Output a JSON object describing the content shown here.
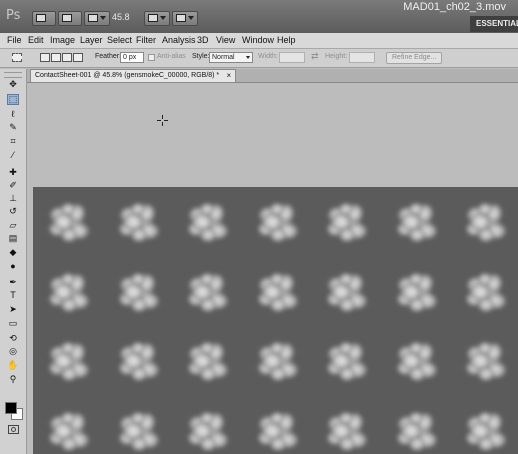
{
  "app": {
    "logo": "Ps",
    "window_title": "MAD01_ch02_3.mov",
    "workspace_label": "ESSENTIAL",
    "zoom_level": "45.8"
  },
  "menu": [
    "File",
    "Edit",
    "Image",
    "Layer",
    "Select",
    "Filter",
    "Analysis",
    "3D",
    "View",
    "Window",
    "Help"
  ],
  "options": {
    "feather_label": "Feather:",
    "feather_value": "0 px",
    "anti_alias_label": "Anti-alias",
    "style_label": "Style:",
    "style_value": "Normal",
    "width_label": "Width:",
    "height_label": "Height:",
    "refine_label": "Refine Edge..."
  },
  "document": {
    "tab_title": "ContactSheet-001 @ 45.8% (gensmokeC_00000, RGB/8) *",
    "close_glyph": "×"
  },
  "contact_sheet": {
    "rows": 4,
    "cols": 7
  },
  "colors": {
    "foreground": "#000000",
    "background": "#ffffff",
    "sheet_bg": "#5b5b5b",
    "active_tool": "#9cb6d6"
  },
  "tools": [
    {
      "icon": "move-tool-icon",
      "glyph": "✥"
    },
    {
      "icon": "rectangular-marquee-icon",
      "glyph": "⬚",
      "active": true
    },
    {
      "icon": "lasso-icon",
      "glyph": "ℓ"
    },
    {
      "icon": "quick-selection-icon",
      "glyph": "✎"
    },
    {
      "icon": "crop-icon",
      "glyph": "⌗"
    },
    {
      "icon": "eyedropper-icon",
      "glyph": "⁄"
    },
    {
      "icon": "healing-brush-icon",
      "glyph": "✚"
    },
    {
      "icon": "brush-icon",
      "glyph": "✐"
    },
    {
      "icon": "clone-stamp-icon",
      "glyph": "⊥"
    },
    {
      "icon": "history-brush-icon",
      "glyph": "↺"
    },
    {
      "icon": "eraser-icon",
      "glyph": "▱"
    },
    {
      "icon": "gradient-icon",
      "glyph": "▤"
    },
    {
      "icon": "blur-icon",
      "glyph": "◆"
    },
    {
      "icon": "dodge-icon",
      "glyph": "●"
    },
    {
      "icon": "pen-icon",
      "glyph": "✒"
    },
    {
      "icon": "type-icon",
      "glyph": "T"
    },
    {
      "icon": "path-selection-icon",
      "glyph": "➤"
    },
    {
      "icon": "shape-icon",
      "glyph": "▭"
    },
    {
      "icon": "3d-rotate-icon",
      "glyph": "⟲"
    },
    {
      "icon": "3d-orbit-icon",
      "glyph": "◎"
    },
    {
      "icon": "hand-icon",
      "glyph": "✋"
    },
    {
      "icon": "zoom-icon",
      "glyph": "⚲"
    }
  ]
}
